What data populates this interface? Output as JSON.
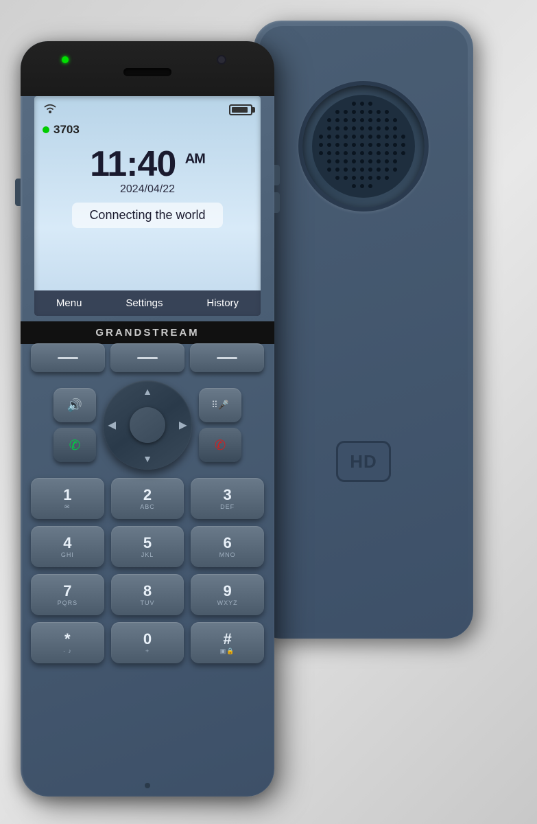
{
  "scene": {
    "background": "#e0e4e8"
  },
  "phone_front": {
    "brand": "GRANDSTREAM",
    "screen": {
      "extension": "3703",
      "time": "11:40",
      "ampm": "AM",
      "date": "2024/04/22",
      "tagline": "Connecting the world",
      "softkeys": [
        "Menu",
        "Settings",
        "History"
      ]
    },
    "keypad": {
      "softkeys": [
        "—",
        "—",
        "—"
      ],
      "digits": [
        {
          "main": "1",
          "sub": "✉"
        },
        {
          "main": "2",
          "sub": "ABC"
        },
        {
          "main": "3",
          "sub": "DEF"
        },
        {
          "main": "4",
          "sub": "GHI"
        },
        {
          "main": "5",
          "sub": "JKL"
        },
        {
          "main": "6",
          "sub": "MNO"
        },
        {
          "main": "7",
          "sub": "PQRS"
        },
        {
          "main": "8",
          "sub": "TUV"
        },
        {
          "main": "9",
          "sub": "WXYZ"
        },
        {
          "main": "*",
          "sub": "·♪"
        },
        {
          "main": "0",
          "sub": "+"
        },
        {
          "main": "#",
          "sub": "▣🔒"
        }
      ]
    }
  },
  "phone_back": {
    "hd_label": "HD"
  }
}
